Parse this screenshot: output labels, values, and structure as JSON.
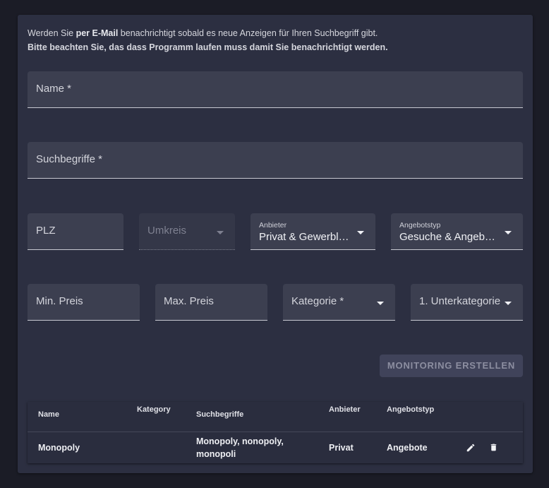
{
  "info": {
    "line1_pre": "Werden Sie ",
    "line1_bold": "per E-Mail",
    "line1_post": " benachrichtigt sobald es neue Anzeigen für Ihren Suchbegriff gibt.",
    "line2": "Bitte beachten Sie, das dass Programm laufen muss damit Sie benachrichtigt werden."
  },
  "form": {
    "name_label": "Name *",
    "search_terms_label": "Suchbegriffe *",
    "plz_label": "PLZ",
    "radius_label": "Umkreis",
    "provider_label": "Anbieter",
    "provider_value": "Privat & Gewerbl…",
    "offer_type_label": "Angebotstyp",
    "offer_type_value": "Gesuche & Angeb…",
    "min_price_label": "Min. Preis",
    "max_price_label": "Max. Preis",
    "category_label": "Kategorie *",
    "subcategory_label": "1. Unterkategorie",
    "submit_label": "MONITORING ERSTELLEN"
  },
  "table": {
    "headers": {
      "name": "Name",
      "category": "Kategory",
      "search_terms": "Suchbegriffe",
      "provider": "Anbieter",
      "offer_type": "Angebotstyp"
    },
    "rows": [
      {
        "name": "Monopoly",
        "category": "",
        "search_terms_line1": "Monopoly, nonopoly,",
        "search_terms_line2": "monopoli",
        "provider": "Privat",
        "offer_type": "Angebote"
      }
    ]
  },
  "icons": {
    "edit": "pencil-icon",
    "delete": "trash-icon"
  }
}
